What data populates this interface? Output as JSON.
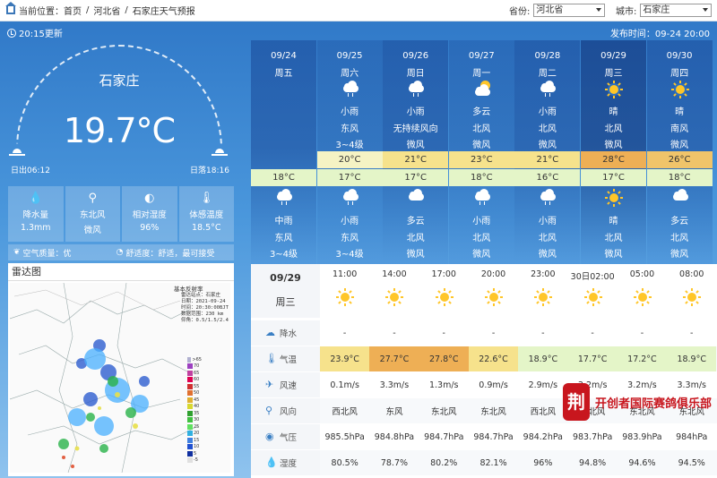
{
  "breadcrumb": {
    "label": "当前位置：",
    "home": "首页",
    "sep": "/",
    "province": "河北省",
    "page": "石家庄天气预报"
  },
  "selectors": {
    "province_label": "省份:",
    "province_value": "河北省",
    "city_label": "城市:",
    "city_value": "石家庄"
  },
  "update": "20:15更新",
  "published": "发布时间：09-24 20:00",
  "current": {
    "city": "石家庄",
    "temp": "19.7°C",
    "sunrise": "日出06:12",
    "sunset": "日落18:16"
  },
  "stats": [
    {
      "label": "降水量",
      "value": "1.3mm",
      "icon": "rain-drop-icon"
    },
    {
      "label": "东北风",
      "value": "微风",
      "icon": "wind-vane-icon"
    },
    {
      "label": "相对湿度",
      "value": "96%",
      "icon": "humidity-icon"
    },
    {
      "label": "体感温度",
      "value": "18.5°C",
      "icon": "thermometer-icon"
    }
  ],
  "air": {
    "quality": "空气质量：优",
    "comfort": "舒适度：舒适，最可接受"
  },
  "radar": {
    "title": "雷达图",
    "map_title": "基本反射率",
    "station": "雷达站点：石家庄",
    "date": "日期：2021-09-24",
    "time": "时间：20:30:00BJT",
    "range": "数据范围：230 km",
    "elev": "仰角：0.5/1.5/2.4",
    "scale": [
      ">65",
      "70",
      "65",
      "60",
      "55",
      "50",
      "45",
      "40",
      "35",
      "30",
      "25",
      "20",
      "15",
      "10",
      "5",
      "-5"
    ]
  },
  "days": [
    {
      "date": "09/24",
      "week": "周五",
      "day_weather": "",
      "day_wind_dir": "",
      "day_wind_pow": "",
      "high": "",
      "low": "18°C",
      "night_weather": "中雨",
      "night_wind_dir": "东风",
      "night_wind_pow": "3~4级",
      "day_icon": "",
      "night_icon": "rain-cloud-icon",
      "hi_color": "",
      "selected": false
    },
    {
      "date": "09/25",
      "week": "周六",
      "day_weather": "小雨",
      "day_wind_dir": "东风",
      "day_wind_pow": "3~4级",
      "high": "20°C",
      "low": "17°C",
      "night_weather": "小雨",
      "night_wind_dir": "东风",
      "night_wind_pow": "3~4级",
      "day_icon": "rain-cloud-icon",
      "night_icon": "rain-cloud-icon",
      "hi_color": "#f5f3c4",
      "selected": false
    },
    {
      "date": "09/26",
      "week": "周日",
      "day_weather": "小雨",
      "day_wind_dir": "无持续风向",
      "day_wind_pow": "微风",
      "high": "21°C",
      "low": "17°C",
      "night_weather": "多云",
      "night_wind_dir": "北风",
      "night_wind_pow": "微风",
      "day_icon": "rain-cloud-icon",
      "night_icon": "cloud-icon",
      "hi_color": "#f6e28c",
      "selected": false
    },
    {
      "date": "09/27",
      "week": "周一",
      "day_weather": "多云",
      "day_wind_dir": "北风",
      "day_wind_pow": "微风",
      "high": "23°C",
      "low": "18°C",
      "night_weather": "小雨",
      "night_wind_dir": "北风",
      "night_wind_pow": "微风",
      "day_icon": "partly-cloudy-icon",
      "night_icon": "rain-cloud-icon",
      "hi_color": "#f6e28c",
      "selected": false
    },
    {
      "date": "09/28",
      "week": "周二",
      "day_weather": "小雨",
      "day_wind_dir": "北风",
      "day_wind_pow": "微风",
      "high": "21°C",
      "low": "16°C",
      "night_weather": "小雨",
      "night_wind_dir": "北风",
      "night_wind_pow": "微风",
      "day_icon": "rain-cloud-icon",
      "night_icon": "rain-cloud-icon",
      "hi_color": "#f6e28c",
      "selected": false
    },
    {
      "date": "09/29",
      "week": "周三",
      "day_weather": "晴",
      "day_wind_dir": "北风",
      "day_wind_pow": "微风",
      "high": "28°C",
      "low": "17°C",
      "night_weather": "晴",
      "night_wind_dir": "北风",
      "night_wind_pow": "微风",
      "day_icon": "sun-icon",
      "night_icon": "sun-icon",
      "hi_color": "#eeaf55",
      "selected": true
    },
    {
      "date": "09/30",
      "week": "周四",
      "day_weather": "晴",
      "day_wind_dir": "南风",
      "day_wind_pow": "微风",
      "high": "26°C",
      "low": "18°C",
      "night_weather": "多云",
      "night_wind_dir": "北风",
      "night_wind_pow": "微风",
      "day_icon": "sun-icon",
      "night_icon": "cloud-icon",
      "hi_color": "#f0c46a",
      "selected": false
    }
  ],
  "hourly": {
    "date": "09/29",
    "week": "周三",
    "times": [
      "11:00",
      "14:00",
      "17:00",
      "20:00",
      "23:00",
      "30日02:00",
      "05:00",
      "08:00"
    ],
    "labels": {
      "precip": "降水",
      "temp": "气温",
      "wind_speed": "风速",
      "wind_dir": "风向",
      "pressure": "气压",
      "humidity": "湿度"
    },
    "precip": [
      "-",
      "-",
      "-",
      "-",
      "-",
      "-",
      "-",
      "-"
    ],
    "temp": [
      "23.9°C",
      "27.7°C",
      "27.8°C",
      "22.6°C",
      "18.9°C",
      "17.7°C",
      "17.2°C",
      "18.9°C"
    ],
    "temp_colors": [
      "#f6e28c",
      "#eeaf55",
      "#eeaf55",
      "#f6e28c",
      "#e4f5c8",
      "#e4f5c8",
      "#e4f5c8",
      "#e4f5c8"
    ],
    "wind_speed": [
      "0.1m/s",
      "3.3m/s",
      "1.3m/s",
      "0.9m/s",
      "2.9m/s",
      "3.2m/s",
      "3.2m/s",
      "3.3m/s"
    ],
    "wind_dir": [
      "西北风",
      "东风",
      "东北风",
      "东北风",
      "西北风",
      "东北风",
      "东北风",
      "东北风"
    ],
    "pressure": [
      "985.5hPa",
      "984.8hPa",
      "984.7hPa",
      "984.7hPa",
      "984.2hPa",
      "983.7hPa",
      "983.9hPa",
      "984hPa"
    ],
    "humidity": [
      "80.5%",
      "78.7%",
      "80.2%",
      "82.1%",
      "96%",
      "94.8%",
      "94.6%",
      "94.5%"
    ]
  },
  "watermark": {
    "logo": "荆",
    "text": "开创者国际赛鸽俱乐部"
  }
}
